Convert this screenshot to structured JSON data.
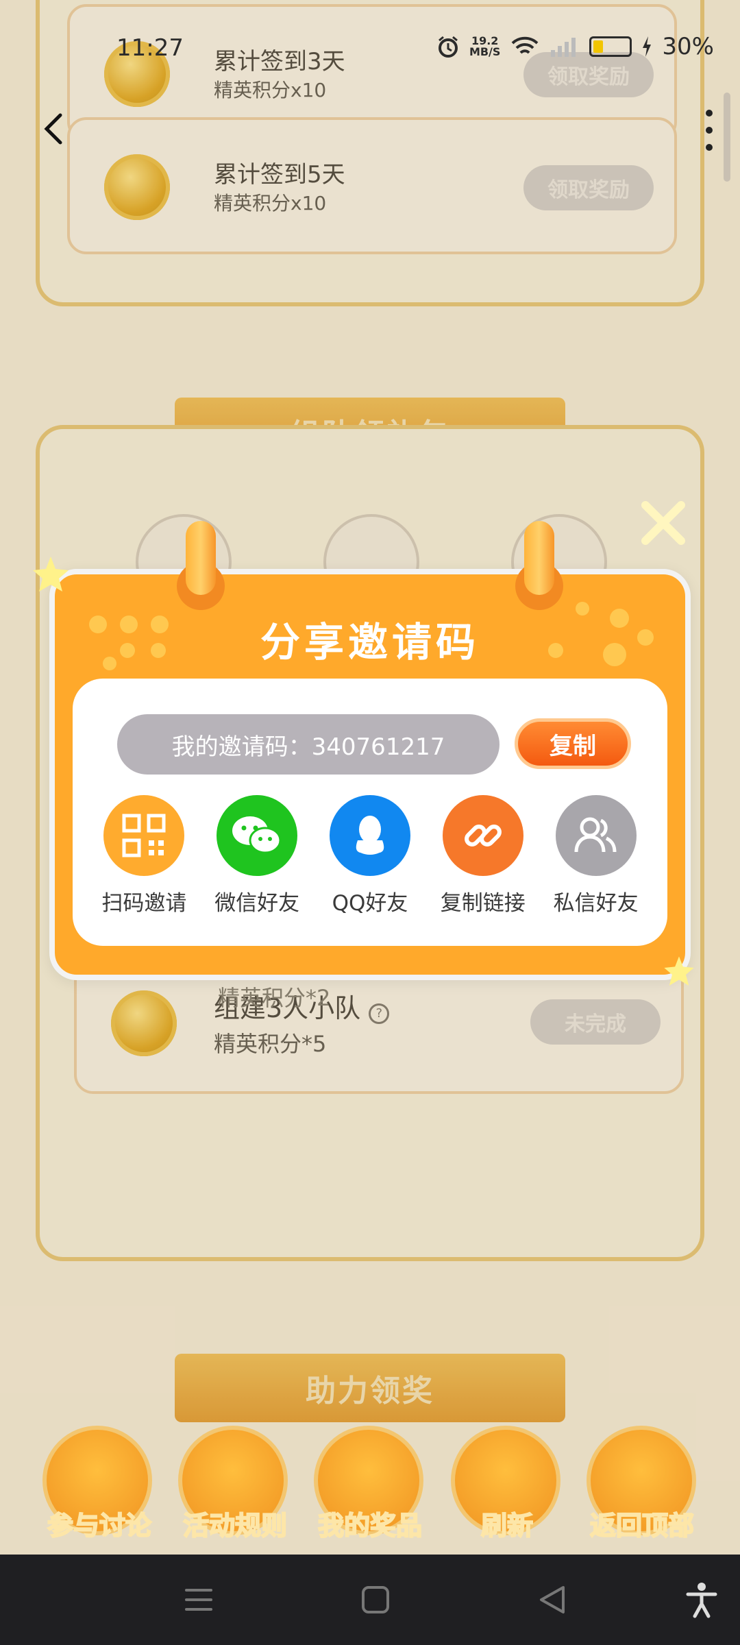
{
  "status_bar": {
    "time": "11:27",
    "net_speed_value": "19.2",
    "net_speed_unit": "MB/S",
    "battery_percent": "30%"
  },
  "signin_section": {
    "cards": [
      {
        "title": "累计签到3天",
        "reward": "精英积分x10",
        "button": "领取奖励"
      },
      {
        "title": "累计签到5天",
        "reward": "精英积分x10",
        "button": "领取奖励"
      }
    ]
  },
  "team_section": {
    "ribbon_title": "组队领礼包",
    "partial_reward": "精英积分*2",
    "card": {
      "title": "组建3人小队",
      "reward": "精英积分*5",
      "button": "未完成"
    }
  },
  "help_section": {
    "ribbon_title": "助力领奖"
  },
  "modal": {
    "title": "分享邀请码",
    "invite_code_text": "我的邀请码：340761217",
    "copy_button": "复制",
    "share_options": [
      {
        "label": "扫码邀请",
        "icon": "qr-code-icon",
        "color": "#ffab2e"
      },
      {
        "label": "微信好友",
        "icon": "wechat-icon",
        "color": "#1fc41f"
      },
      {
        "label": "QQ好友",
        "icon": "qq-icon",
        "color": "#1188f0"
      },
      {
        "label": "复制链接",
        "icon": "link-icon",
        "color": "#f6782a"
      },
      {
        "label": "私信好友",
        "icon": "friends-icon",
        "color": "#a8a6ab"
      }
    ]
  },
  "toolbar": {
    "items": [
      {
        "label": "参与讨论",
        "icon": "chat-icon"
      },
      {
        "label": "活动规则",
        "icon": "rules-icon"
      },
      {
        "label": "我的奖品",
        "icon": "gift-icon"
      },
      {
        "label": "刷新",
        "icon": "refresh-icon"
      },
      {
        "label": "返回顶部",
        "icon": "upload-top-icon"
      }
    ]
  },
  "colors": {
    "accent_orange": "#ffa92b",
    "copy_orange": "#f45a10"
  }
}
